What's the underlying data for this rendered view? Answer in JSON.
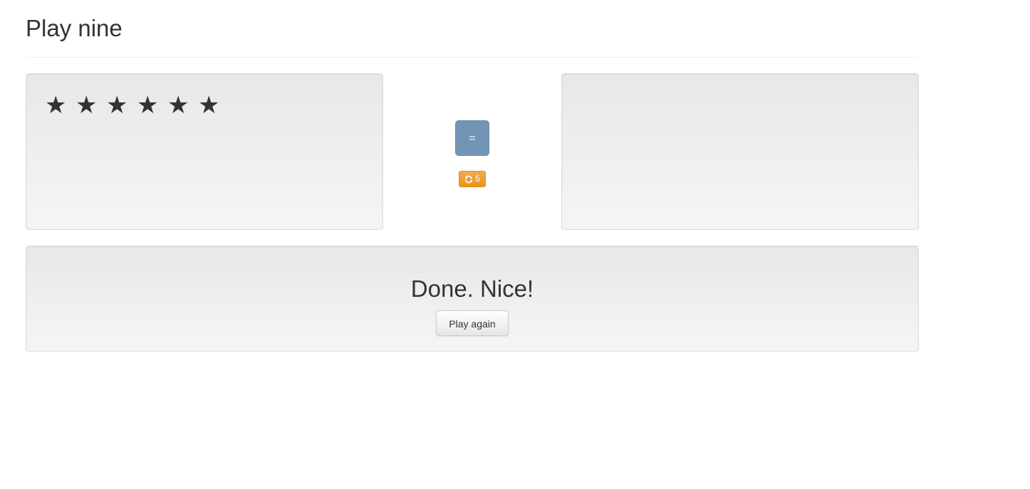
{
  "header": {
    "title": "Play nine"
  },
  "stars": {
    "count": 6,
    "glyph": "★",
    "items": [
      "★",
      "★",
      "★",
      "★",
      "★",
      "★"
    ]
  },
  "controls": {
    "check_label": "=",
    "check_color": "#7395b5",
    "redraw_count": "5",
    "redraw_icon": "refresh-icon",
    "redraw_color": "#f0ad4e"
  },
  "answer": {
    "numbers": []
  },
  "result": {
    "message": "Done. Nice!",
    "play_again_label": "Play again"
  }
}
